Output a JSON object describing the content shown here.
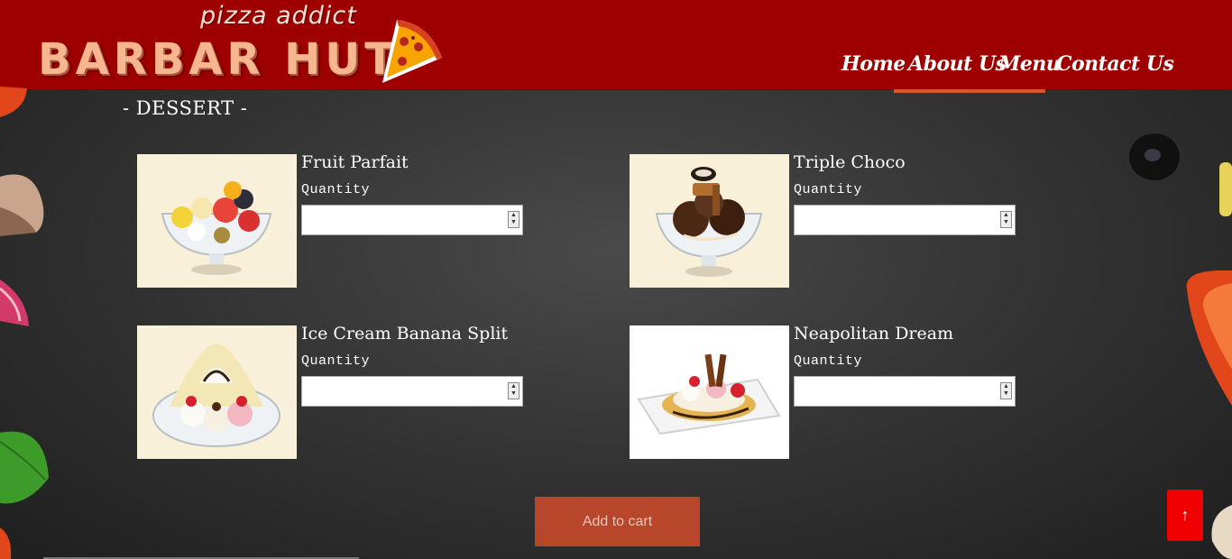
{
  "header": {
    "tagline": "pizza addict",
    "brand": "BARBAR HUT",
    "logo_icon": "pizza-slice-icon"
  },
  "nav": {
    "items": [
      {
        "label": "Home"
      },
      {
        "label": "About Us",
        "active": true
      },
      {
        "label": "Menu"
      },
      {
        "label": "Contact Us"
      }
    ]
  },
  "section": {
    "title": "- DESSERT -"
  },
  "products": [
    {
      "name": "Fruit Parfait",
      "quantity_label": "Quantity",
      "quantity": ""
    },
    {
      "name": "Triple Choco",
      "quantity_label": "Quantity",
      "quantity": ""
    },
    {
      "name": "Ice Cream Banana Split",
      "quantity_label": "Quantity",
      "quantity": ""
    },
    {
      "name": "Neapolitan Dream",
      "quantity_label": "Quantity",
      "quantity": ""
    }
  ],
  "actions": {
    "add_to_cart": "Add to cart",
    "back_to_top": "↑"
  },
  "colors": {
    "header_bg": "#9e0000",
    "accent": "#d45a2a",
    "cart_button": "#b8462a",
    "top_button": "#f00000"
  }
}
